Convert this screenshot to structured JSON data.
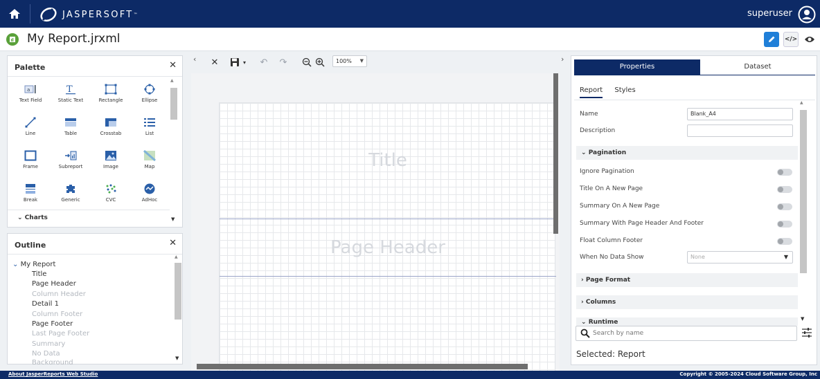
{
  "topbar": {
    "logo_text": "JASPERSOFT",
    "logo_mark": "™",
    "user": "superuser"
  },
  "titlebar": {
    "title": "My Report.jrxml"
  },
  "palette": {
    "title": "Palette",
    "items": [
      "Text Field",
      "Static Text",
      "Rectangle",
      "Ellipse",
      "Line",
      "Table",
      "Crosstab",
      "List",
      "Frame",
      "Subreport",
      "Image",
      "Map",
      "Break",
      "Generic",
      "CVC",
      "AdHoc"
    ],
    "charts_label": "Charts"
  },
  "outline": {
    "title": "Outline",
    "root": "My Report",
    "items": [
      "Title",
      "Page Header",
      "Column Header",
      "Detail 1",
      "Column Footer",
      "Page Footer",
      "Last Page Footer",
      "Summary",
      "No Data",
      "Background"
    ]
  },
  "toolbar": {
    "zoom": "100%"
  },
  "canvas": {
    "bands": [
      "Title",
      "Page Header"
    ]
  },
  "properties": {
    "tabs": [
      "Properties",
      "Dataset"
    ],
    "subtabs": [
      "Report",
      "Styles"
    ],
    "name_label": "Name",
    "name_value": "Blank_A4",
    "description_label": "Description",
    "description_value": "",
    "pagination_label": "Pagination",
    "toggles": [
      "Ignore Pagination",
      "Title On A New Page",
      "Summary On A New Page",
      "Summary With Page Header And Footer",
      "Float Column Footer"
    ],
    "no_data_label": "When No Data Show",
    "no_data_value": "None",
    "sections": [
      "Page Format",
      "Columns",
      "Runtime"
    ],
    "search_placeholder": "Search by name",
    "selected": "Selected: Report"
  },
  "footer": {
    "left": "About JasperReports Web Studio",
    "right": "Copyright © 2005-2024 Cloud Software Group, Inc"
  },
  "colors": {
    "brand": "#0d2a66",
    "accent": "#1f7fd8",
    "report_icon": "#5aa13a"
  }
}
